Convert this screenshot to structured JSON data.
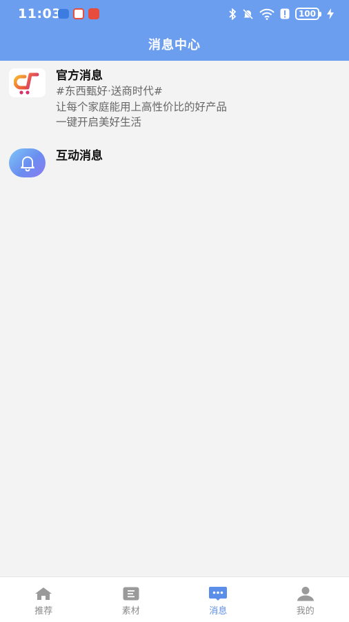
{
  "status_bar": {
    "time": "11:03",
    "battery": "100"
  },
  "header": {
    "title": "消息中心"
  },
  "messages": [
    {
      "title": "官方消息",
      "lines": [
        "#东西甄好·送商时代#",
        "让每个家庭能用上高性价比的好产品",
        "一键开启美好生活"
      ],
      "icon": "brand-logo-icon"
    },
    {
      "title": "互动消息",
      "lines": [],
      "icon": "bell-icon"
    }
  ],
  "nav": {
    "items": [
      {
        "label": "推荐",
        "icon": "home-icon"
      },
      {
        "label": "素材",
        "icon": "material-icon"
      },
      {
        "label": "消息",
        "icon": "message-icon"
      },
      {
        "label": "我的",
        "icon": "user-icon"
      }
    ],
    "active_index": 2
  },
  "colors": {
    "header_bg": "#6c9ef0",
    "page_bg": "#f3f3f3",
    "nav_active": "#5b8ee8",
    "nav_inactive": "#8a8a8a"
  }
}
